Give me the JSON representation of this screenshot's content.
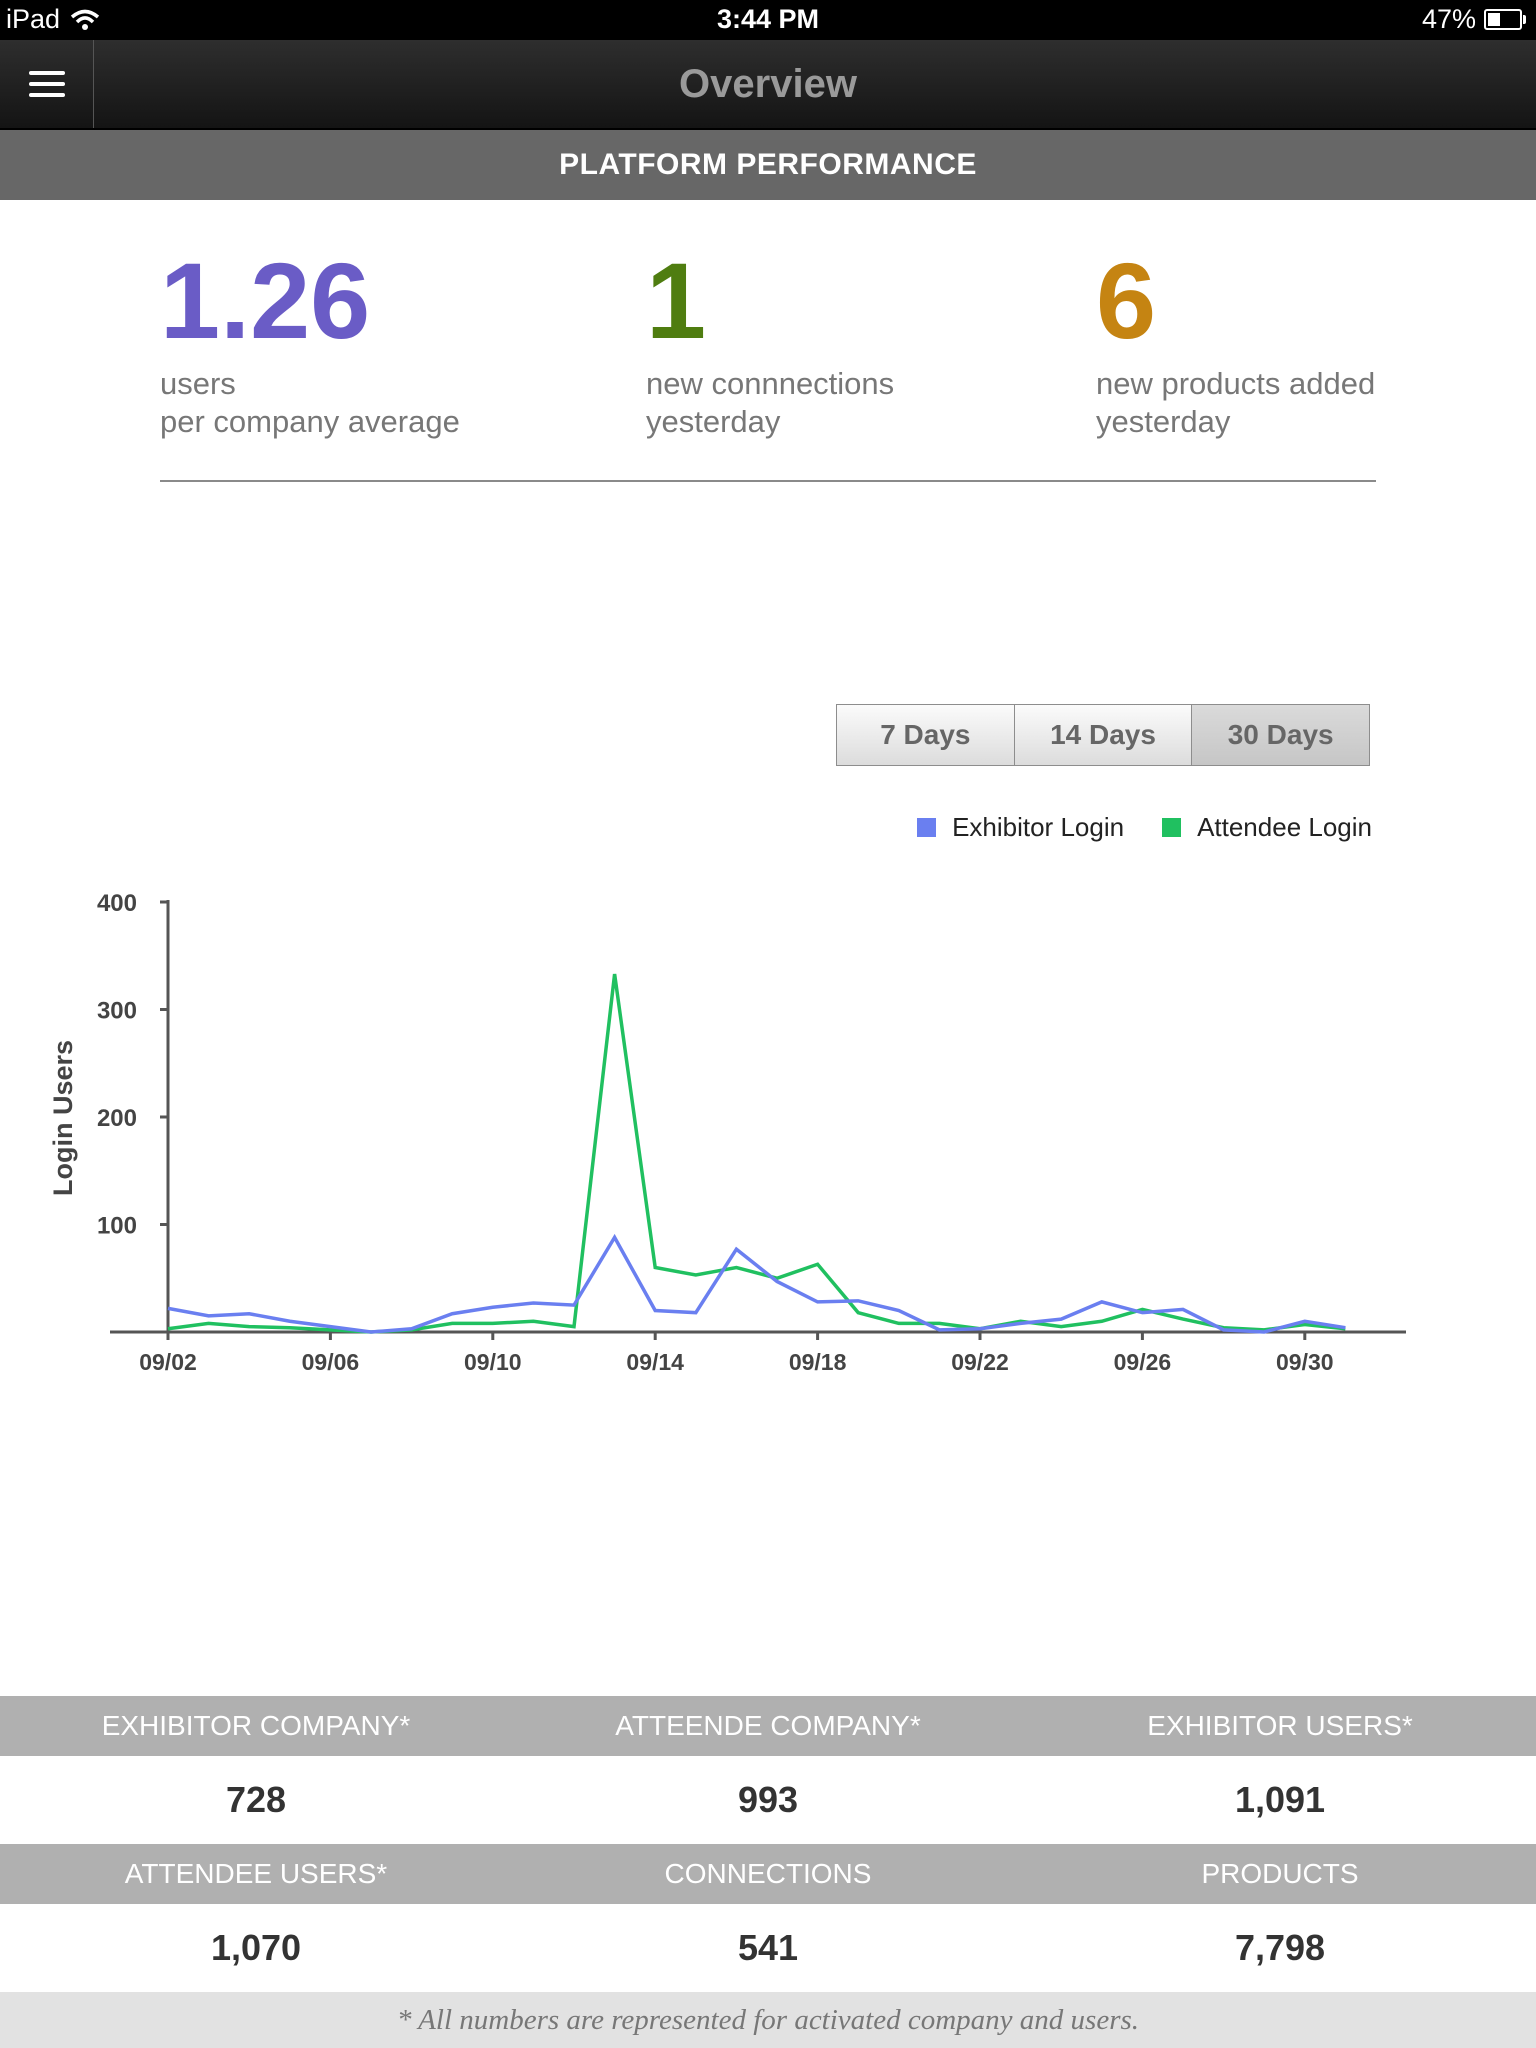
{
  "status_bar": {
    "device": "iPad",
    "time": "3:44 PM",
    "battery": "47%",
    "battery_level": 0.47
  },
  "nav": {
    "title": "Overview",
    "menu_icon": "hamburger-menu-icon"
  },
  "section": {
    "title": "PLATFORM PERFORMANCE"
  },
  "kpis": [
    {
      "value": "1.26",
      "line1": "users",
      "line2": "per company average",
      "color": "#6a5cc6"
    },
    {
      "value": "1",
      "line1": "new connnections",
      "line2": "yesterday",
      "color": "#4f7d10"
    },
    {
      "value": "6",
      "line1": "new products added",
      "line2": "yesterday",
      "color": "#c58412"
    }
  ],
  "range_buttons": [
    {
      "label": "7 Days",
      "active": false
    },
    {
      "label": "14 Days",
      "active": false
    },
    {
      "label": "30 Days",
      "active": true
    }
  ],
  "chart_data": {
    "type": "line",
    "ylabel": "Login Users",
    "ylim": [
      0,
      400
    ],
    "yticks": [
      100,
      200,
      300,
      400
    ],
    "x_tick_labels": [
      "09/02",
      "09/06",
      "09/10",
      "09/14",
      "09/18",
      "09/22",
      "09/26",
      "09/30"
    ],
    "x": [
      "09/02",
      "09/03",
      "09/04",
      "09/05",
      "09/06",
      "09/07",
      "09/08",
      "09/09",
      "09/10",
      "09/11",
      "09/12",
      "09/13",
      "09/14",
      "09/15",
      "09/16",
      "09/17",
      "09/18",
      "09/19",
      "09/20",
      "09/21",
      "09/22",
      "09/23",
      "09/24",
      "09/25",
      "09/26",
      "09/27",
      "09/28",
      "09/29",
      "09/30",
      "10/01"
    ],
    "series": [
      {
        "name": "Exhibitor Login",
        "color": "#6a7ff0",
        "values": [
          22,
          15,
          17,
          10,
          5,
          0,
          3,
          17,
          23,
          27,
          25,
          88,
          20,
          18,
          77,
          47,
          28,
          29,
          20,
          2,
          3,
          8,
          12,
          28,
          18,
          21,
          2,
          0,
          10,
          4
        ]
      },
      {
        "name": "Attendee Login",
        "color": "#20c060",
        "values": [
          3,
          8,
          5,
          4,
          2,
          0,
          2,
          8,
          8,
          10,
          5,
          333,
          60,
          53,
          60,
          50,
          63,
          18,
          8,
          8,
          3,
          10,
          5,
          10,
          21,
          12,
          4,
          2,
          7,
          3
        ]
      }
    ],
    "legend": "top-right",
    "grid": false
  },
  "stats": {
    "rows": [
      {
        "headers": [
          "EXHIBITOR COMPANY*",
          "ATTEENDE COMPANY*",
          "EXHIBITOR USERS*"
        ],
        "values": [
          "728",
          "993",
          "1,091"
        ]
      },
      {
        "headers": [
          "ATTENDEE USERS*",
          "CONNECTIONS",
          "PRODUCTS"
        ],
        "values": [
          "1,070",
          "541",
          "7,798"
        ]
      }
    ]
  },
  "footnote": "* All numbers are represented for activated company and users."
}
